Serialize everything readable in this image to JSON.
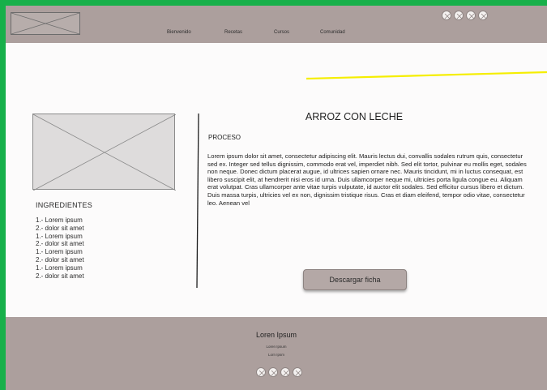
{
  "header": {
    "nav": [
      "Bienvenido",
      "Recetas",
      "Cursos",
      "Comunidad"
    ]
  },
  "sidebar": {
    "ingredients_title": "INGREDIENTES",
    "ingredients": [
      "1.- Lorem ipsum",
      "2.- dolor sit amet",
      "1.- Lorem ipsum",
      "2.- dolor sit amet",
      "1.- Lorem ipsum",
      "2.- dolor sit amet",
      "1.- Lorem ipsum",
      "2.- dolor sit amet"
    ]
  },
  "main": {
    "title": "ARROZ CON LECHE",
    "section_title": "PROCESO",
    "body": "Lorem ipsum dolor sit amet, consectetur adipiscing elit. Mauris lectus dui, convallis sodales rutrum quis, consectetur sed ex. Integer sed tellus dignissim, commodo erat vel, imperdiet nibh. Sed elit tortor, pulvinar eu mollis eget, sodales non neque. Donec dictum placerat augue, id ultrices sapien ornare nec. Mauris tincidunt, mi in luctus consequat, est libero suscipit elit, at hendrerit nisi eros id urna. Duis ullamcorper neque mi, ultricies porta ligula congue eu. Aliquam erat volutpat. Cras ullamcorper ante vitae turpis vulputate, id auctor elit sodales. Sed efficitur cursus libero et dictum. Duis massa turpis, ultricies vel ex non, dignissim tristique risus. Cras et diam eleifend, tempor odio vitae, consectetur leo. Aenean vel",
    "download_label": "Descargar ficha"
  },
  "footer": {
    "title": "Loren Ipsum",
    "line1": "Loren Ipsum",
    "line2": "Lorn Ipsm"
  },
  "icons": {
    "social_top": [
      "social-icon",
      "social-icon",
      "social-icon",
      "social-icon"
    ],
    "social_bottom": [
      "social-icon",
      "social-icon",
      "social-icon",
      "social-icon"
    ]
  },
  "colors": {
    "frame": "#17b04a",
    "header_footer": "#ac9f9d",
    "accent_line": "#f5ee00",
    "button": "#b4a8a6"
  }
}
